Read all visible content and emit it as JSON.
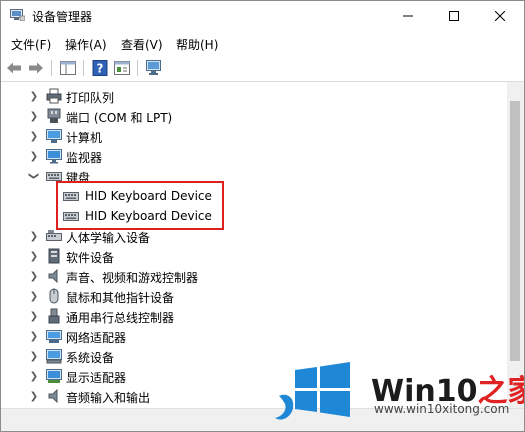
{
  "window": {
    "title": "设备管理器"
  },
  "menu": {
    "items": [
      "文件(F)",
      "操作(A)",
      "查看(V)",
      "帮助(H)"
    ]
  },
  "tree": {
    "items": [
      {
        "label": "打印队列",
        "icon": "printer-icon",
        "expanded": false
      },
      {
        "label": "端口 (COM 和 LPT)",
        "icon": "port-icon",
        "expanded": false
      },
      {
        "label": "计算机",
        "icon": "computer-icon",
        "expanded": false
      },
      {
        "label": "监视器",
        "icon": "monitor-icon",
        "expanded": false
      },
      {
        "label": "键盘",
        "icon": "keyboard-icon",
        "expanded": true
      },
      {
        "label": "HID Keyboard Device",
        "icon": "keyboard-icon",
        "child": true
      },
      {
        "label": "HID Keyboard Device",
        "icon": "keyboard-icon",
        "child": true
      },
      {
        "label": "人体学输入设备",
        "icon": "hid-icon",
        "expanded": false
      },
      {
        "label": "软件设备",
        "icon": "software-device-icon",
        "expanded": false
      },
      {
        "label": "声音、视频和游戏控制器",
        "icon": "speaker-icon",
        "expanded": false
      },
      {
        "label": "鼠标和其他指针设备",
        "icon": "mouse-icon",
        "expanded": false
      },
      {
        "label": "通用串行总线控制器",
        "icon": "usb-icon",
        "expanded": false
      },
      {
        "label": "网络适配器",
        "icon": "network-adapter-icon",
        "expanded": false
      },
      {
        "label": "系统设备",
        "icon": "system-device-icon",
        "expanded": false
      },
      {
        "label": "显示适配器",
        "icon": "display-adapter-icon",
        "expanded": false
      },
      {
        "label": "音频输入和输出",
        "icon": "audio-io-icon",
        "expanded": false
      }
    ]
  },
  "watermark": {
    "brand_main": "Win10",
    "brand_accent": "之家",
    "url": "www.win10xitong.com"
  },
  "colors": {
    "highlight": "#e0201f",
    "logo_blue": "#1e88d6"
  }
}
